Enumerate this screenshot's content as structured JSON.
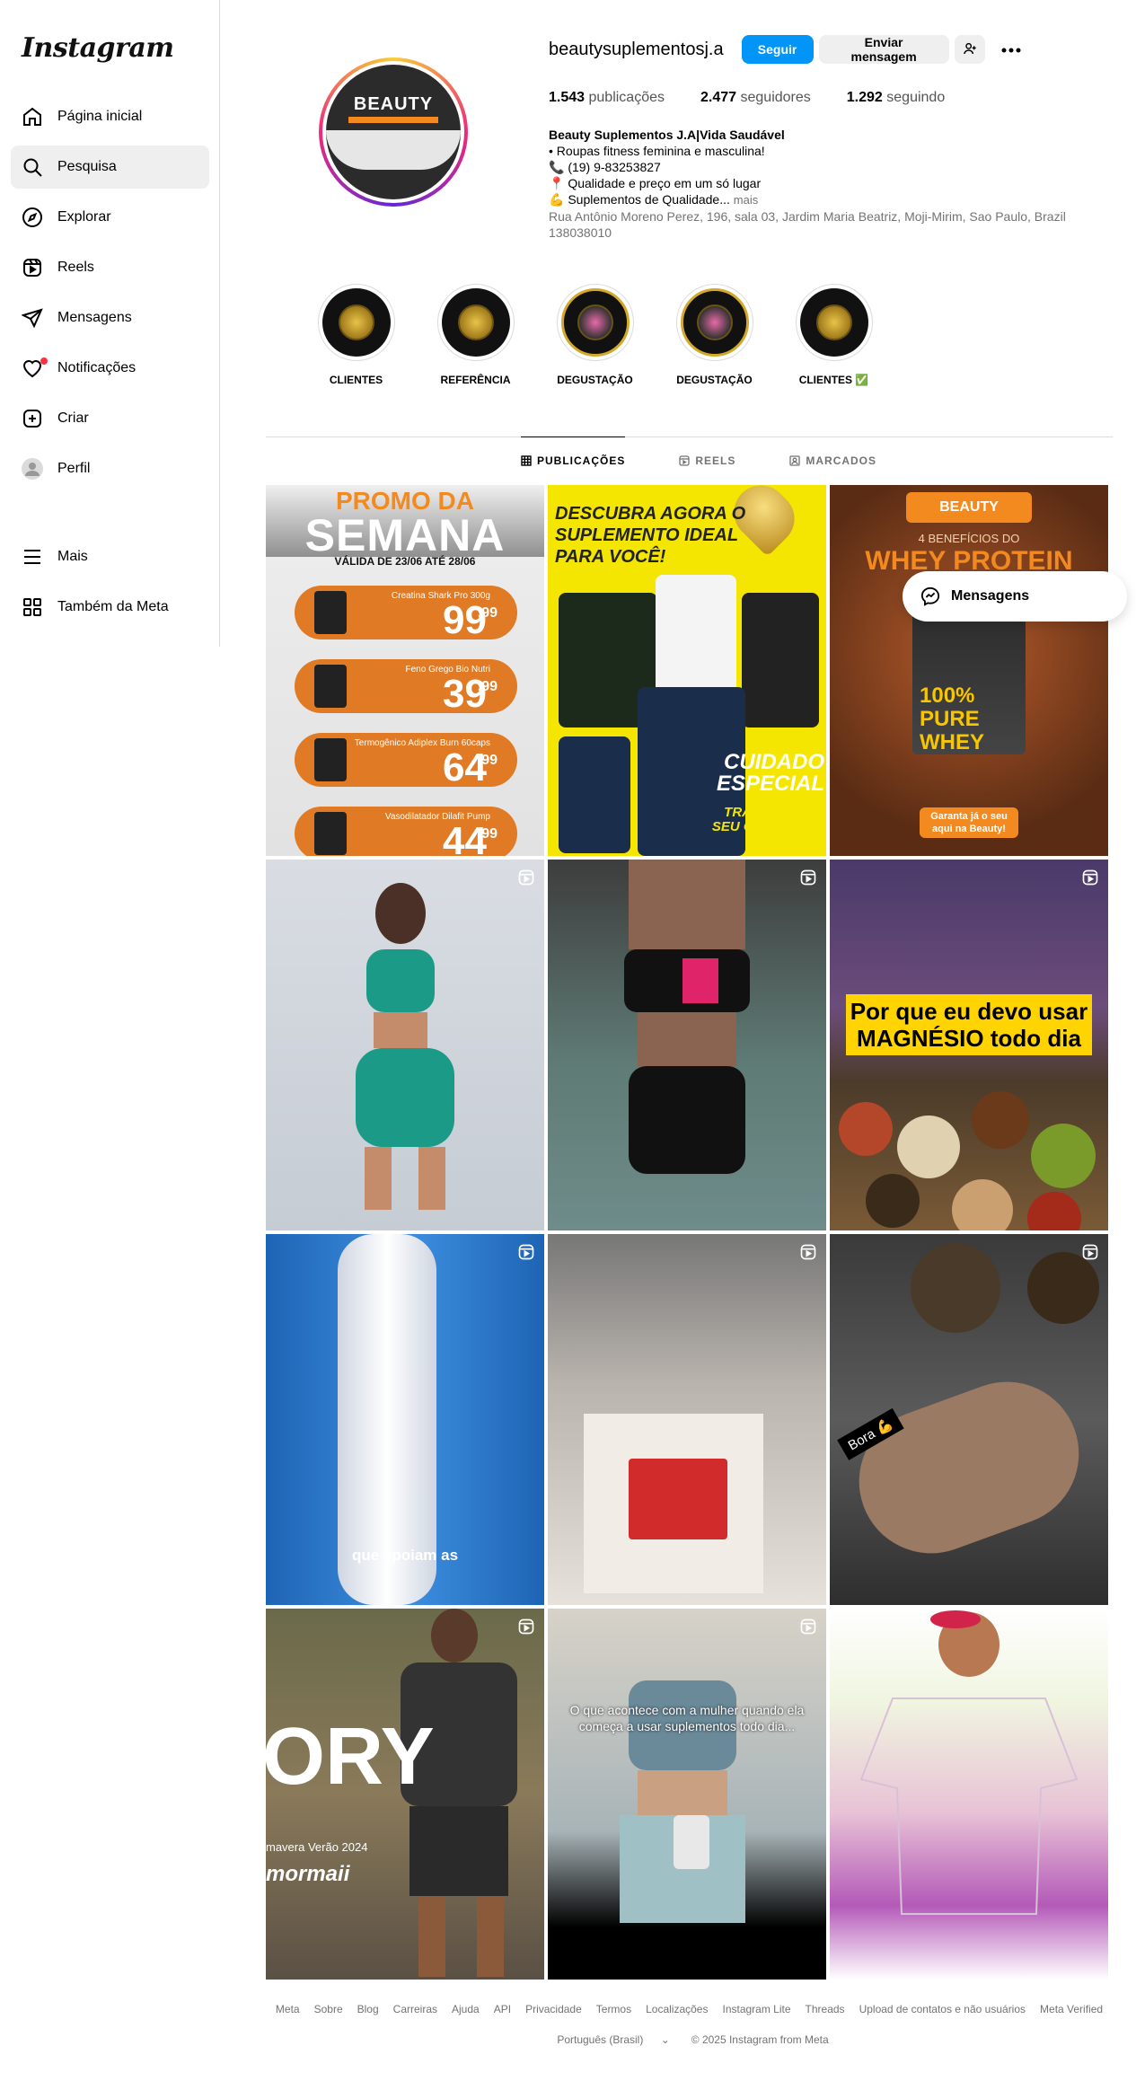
{
  "sidebar": {
    "logo": "Instagram",
    "items": [
      {
        "label": "Página inicial",
        "icon": "home-icon"
      },
      {
        "label": "Pesquisa",
        "icon": "search-icon"
      },
      {
        "label": "Explorar",
        "icon": "compass-icon"
      },
      {
        "label": "Reels",
        "icon": "reels-icon"
      },
      {
        "label": "Mensagens",
        "icon": "send-icon"
      },
      {
        "label": "Notificações",
        "icon": "heart-icon"
      },
      {
        "label": "Criar",
        "icon": "plus-square-icon"
      },
      {
        "label": "Perfil",
        "icon": "avatar-icon"
      }
    ],
    "bottom": [
      {
        "label": "Mais",
        "icon": "menu-icon"
      },
      {
        "label": "Também da Meta",
        "icon": "meta-apps-icon"
      }
    ]
  },
  "profile": {
    "avatar_text": "BEAUTY",
    "username": "beautysuplementosj.a",
    "follow_label": "Seguir",
    "message_label": "Enviar mensagem",
    "stats": {
      "posts_count": "1.543",
      "posts_label": "publicações",
      "followers_count": "2.477",
      "followers_label": "seguidores",
      "following_count": "1.292",
      "following_label": "seguindo"
    },
    "bio": {
      "name": "Beauty Suplementos J.A|Vida Saudável",
      "line1": "• Roupas fitness feminina e masculina!",
      "line2": "📞 (19) 9-83253827",
      "line3": "📍 Qualidade e preço em um só lugar",
      "line4": "💪 Suplementos de Qualidade...",
      "more": "mais",
      "address": "Rua Antônio Moreno Perez, 196, sala 03, Jardim Maria Beatriz, Moji-Mirim, Sao Paulo, Brazil 138038010"
    }
  },
  "highlights": [
    {
      "label": "CLIENTES"
    },
    {
      "label": "REFERÊNCIA"
    },
    {
      "label": "DEGUSTAÇÃO"
    },
    {
      "label": "DEGUSTAÇÃO"
    },
    {
      "label": "CLIENTES ✅"
    }
  ],
  "tabs": [
    {
      "label": "PUBLICAÇÕES",
      "active": true
    },
    {
      "label": "REELS",
      "active": false
    },
    {
      "label": "MARCADOS",
      "active": false
    }
  ],
  "posts": {
    "p1": {
      "title_a": "PROMO DA",
      "title_b": "SEMANA",
      "validity": "VÁLIDA DE 23/06 ATÉ 28/06",
      "items": [
        {
          "name": "Creatina Shark Pro 300g",
          "price": "99",
          "cents": ",99"
        },
        {
          "name": "Feno Grego Bio Nutri",
          "price": "39",
          "cents": ",99"
        },
        {
          "name": "Termogênico Adiplex Burn 60caps",
          "price": "64",
          "cents": ",99"
        },
        {
          "name": "Vasodilatador Dilafit Pump",
          "price": "44",
          "cents": ",99"
        }
      ]
    },
    "p2": {
      "headline": "DESCUBRA AGORA O SUPLEMENTO IDEAL PARA VOCÊ!",
      "cuidado": "CUIDADO ESPECIAL",
      "transforme": "TRANSFORME SEU COTIDIANO"
    },
    "p3": {
      "badge": "BEAUTY",
      "benefits": "4 BENEFÍCIOS DO",
      "title": "WHEY PROTEIN",
      "pure": "100% PURE WHEY",
      "cta": "Garanta já o seu aqui na Beauty!"
    },
    "p6": {
      "caption": "Por que eu devo usar MAGNÉSIO todo dia"
    },
    "p7": {
      "subtitle": "que apoiam as"
    },
    "p9": {
      "sticker": "Bora 💪"
    },
    "p10": {
      "big": "ORY",
      "season": "mavera Verão 2024",
      "brand": "mormaii"
    },
    "p11": {
      "caption": "O que acontece com a mulher quando ela começa a usar suplementos todo dia..."
    }
  },
  "messages_pill": {
    "label": "Mensagens"
  },
  "footer": {
    "links": [
      "Meta",
      "Sobre",
      "Blog",
      "Carreiras",
      "Ajuda",
      "API",
      "Privacidade",
      "Termos",
      "Localizações",
      "Instagram Lite",
      "Threads",
      "Upload de contatos e não usuários",
      "Meta Verified"
    ],
    "language": "Português (Brasil)",
    "copyright": "© 2025 Instagram from Meta"
  },
  "colors": {
    "accent": "#0095f6",
    "brand_orange": "#f28a1f",
    "notification": "#ff3040"
  }
}
